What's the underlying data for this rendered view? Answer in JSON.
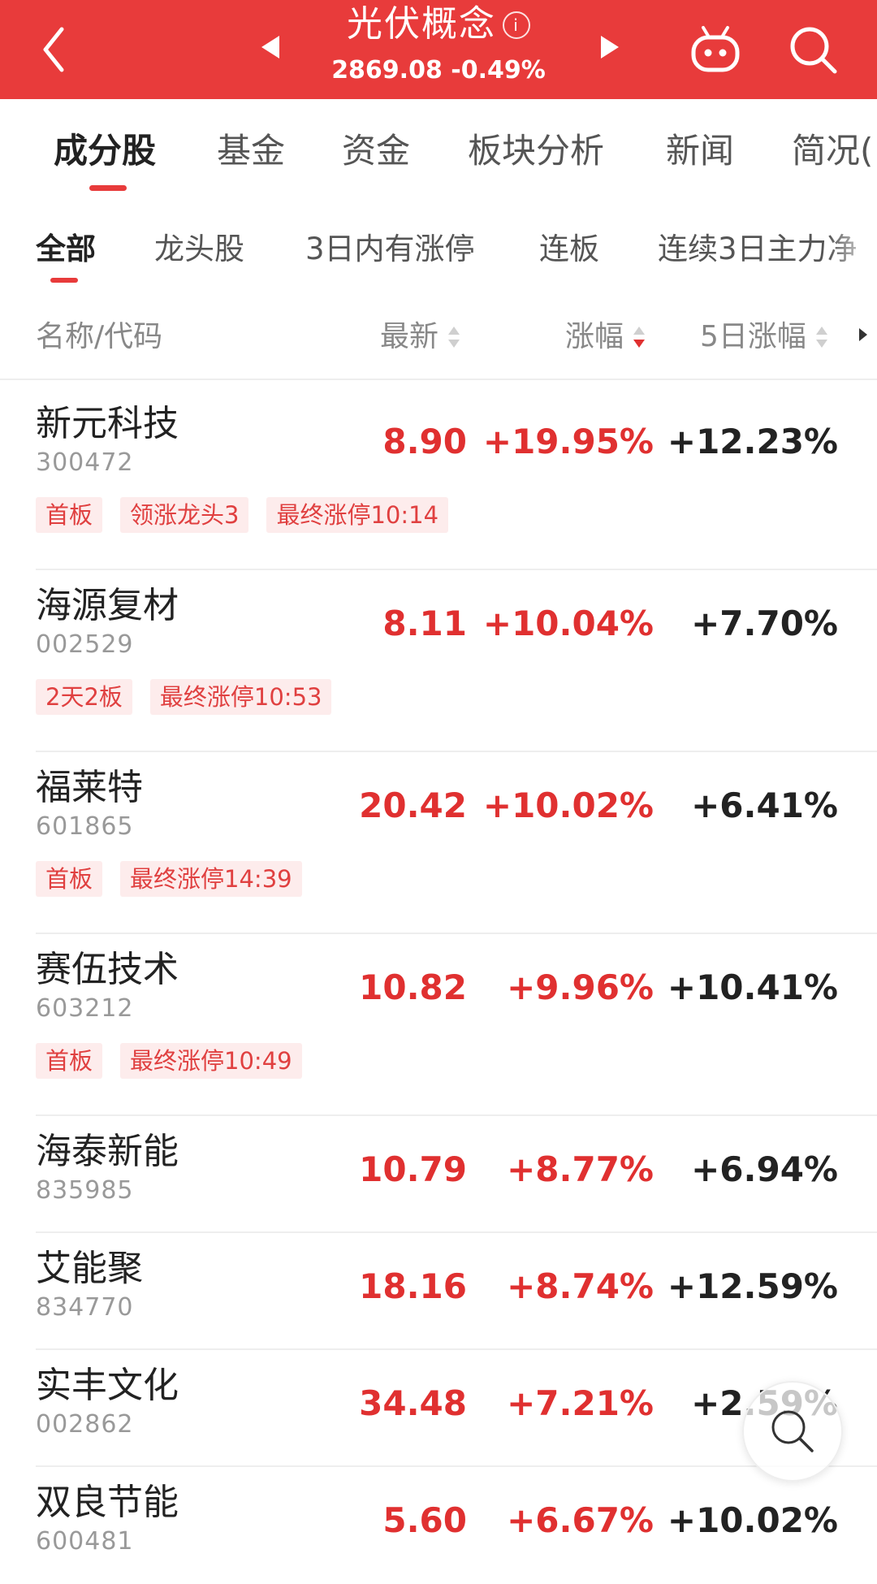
{
  "header": {
    "title": "光伏概念",
    "info_icon_glyph": "i",
    "index_value": "2869.08",
    "index_change": "-0.49%",
    "color": "#e83b3b"
  },
  "main_tabs": [
    "成分股",
    "基金",
    "资金",
    "板块分析",
    "新闻",
    "简况("
  ],
  "sub_tabs": [
    "全部",
    "龙头股",
    "3日内有涨停",
    "连板",
    "连续3日主力净"
  ],
  "columns": {
    "name": "名称/代码",
    "latest": "最新",
    "change": "涨幅",
    "change5d": "5日涨幅"
  },
  "stocks": [
    {
      "name": "新元科技",
      "code": "300472",
      "price": "8.90",
      "change": "+19.95%",
      "change5d": "+12.23%",
      "tags": [
        "首板",
        "领涨龙头3",
        "最终涨停10:14"
      ]
    },
    {
      "name": "海源复材",
      "code": "002529",
      "price": "8.11",
      "change": "+10.04%",
      "change5d": "+7.70%",
      "tags": [
        "2天2板",
        "最终涨停10:53"
      ]
    },
    {
      "name": "福莱特",
      "code": "601865",
      "price": "20.42",
      "change": "+10.02%",
      "change5d": "+6.41%",
      "tags": [
        "首板",
        "最终涨停14:39"
      ]
    },
    {
      "name": "赛伍技术",
      "code": "603212",
      "price": "10.82",
      "change": "+9.96%",
      "change5d": "+10.41%",
      "tags": [
        "首板",
        "最终涨停10:49"
      ]
    },
    {
      "name": "海泰新能",
      "code": "835985",
      "price": "10.79",
      "change": "+8.77%",
      "change5d": "+6.94%",
      "tags": []
    },
    {
      "name": "艾能聚",
      "code": "834770",
      "price": "18.16",
      "change": "+8.74%",
      "change5d": "+12.59%",
      "tags": []
    },
    {
      "name": "实丰文化",
      "code": "002862",
      "price": "34.48",
      "change": "+7.21%",
      "change5d": "+2.59%",
      "tags": []
    },
    {
      "name": "双良节能",
      "code": "600481",
      "price": "5.60",
      "change": "+6.67%",
      "change5d": "+10.02%",
      "tags": []
    }
  ],
  "colors": {
    "up": "#e03030",
    "tag_bg": "#fdecec",
    "tag_text": "#e04040"
  }
}
